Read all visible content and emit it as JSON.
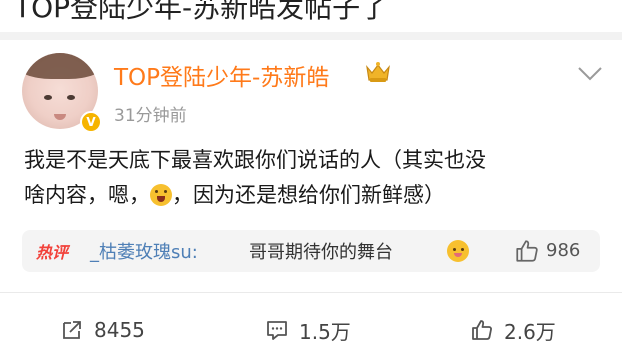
{
  "header": {
    "caption": "TOP登陆少年-苏新皓发帖子了"
  },
  "post": {
    "username": "TOP登陆少年-苏新皓",
    "time": "31分钟前",
    "text_line1": "我是不是天底下最喜欢跟你们说话的人（其实也没",
    "text_line2_a": "啥内容，嗯，",
    "text_line2_b": "，因为还是想给你们新鲜感）",
    "icons": {
      "user_badge": "crown-icon",
      "verified": "v-badge-icon",
      "menu": "chevron-down-icon",
      "emoji": "emoji-icon"
    }
  },
  "hot_comment": {
    "label": "热评",
    "user": "_枯萎玫瑰su:",
    "text": "哥哥期待你的舞台",
    "likes": "986"
  },
  "footer": {
    "share_count": "8455",
    "comment_count": "1.5万",
    "like_count": "2.6万"
  },
  "colors": {
    "username": "#ff7a1a",
    "hot_label": "#f2413a",
    "comment_user": "#4e7fb6"
  }
}
